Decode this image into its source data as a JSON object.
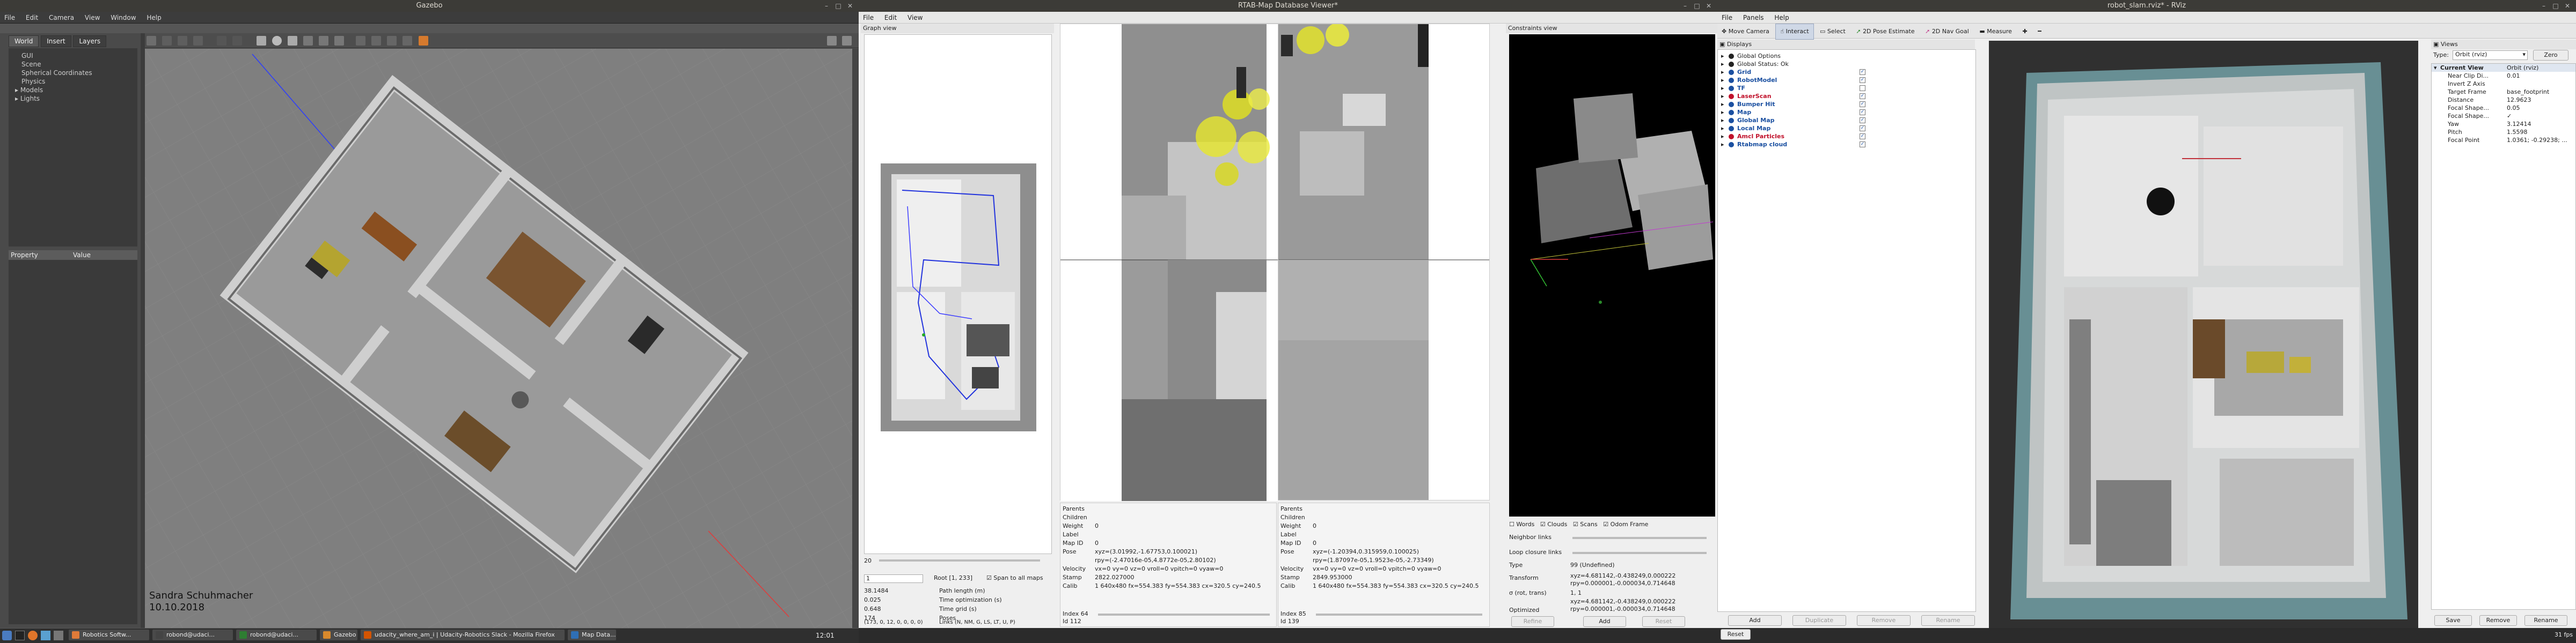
{
  "gazebo": {
    "title": "Gazebo",
    "menu": [
      "File",
      "Edit",
      "Camera",
      "View",
      "Window",
      "Help"
    ],
    "tabs": [
      "World",
      "Insert",
      "Layers"
    ],
    "tree": [
      "GUI",
      "Scene",
      "Spherical Coordinates",
      "Physics",
      "Models",
      "Lights"
    ],
    "prop_headers": [
      "Property",
      "Value"
    ],
    "watermark_name": "Sandra Schuhmacher",
    "watermark_date": "10.10.2018"
  },
  "rtabmap": {
    "title": "RTAB-Map Database Viewer*",
    "menu": [
      "File",
      "Edit",
      "View"
    ],
    "graph_view_title": "Graph view",
    "constraints_view_title": "Constraints view",
    "left_info": {
      "labels": [
        "Parents",
        "Children",
        "Weight",
        "Label",
        "Map ID",
        "Pose",
        "",
        "Velocity",
        "Stamp",
        "Calib"
      ],
      "values": [
        "",
        "",
        "0",
        "",
        "0",
        "xyz=(3.01992,-1.67753,0.100021)",
        "rpy=(-2.47016e-05,4.8772e-05,2.80102)",
        "vx=0 vy=0 vz=0 vroll=0 vpitch=0 vyaw=0",
        "2822.027000",
        "1 640x480 fx=554.383 fy=554.383 cx=320.5 cy=240.5"
      ],
      "index_label": "Index 64",
      "id_label": "Id 112"
    },
    "right_info": {
      "labels": [
        "Parents",
        "Children",
        "Weight",
        "Label",
        "Map ID",
        "Pose",
        "",
        "Velocity",
        "Stamp",
        "Calib"
      ],
      "values": [
        "",
        "",
        "0",
        "",
        "0",
        "xyz=(-1.20394,0.315959,0.100025)",
        "rpy=(1.87097e-05,1.9523e-05,-2.73349)",
        "vx=0 vy=0 vz=0 vroll=0 vpitch=0 vyaw=0",
        "2849.953000",
        "1 640x480 fx=554.383 fy=554.383 cx=320.5 cy=240.5"
      ],
      "index_label": "Index 85",
      "id_label": "Id 139"
    },
    "graph_controls": {
      "spin1": "20",
      "spin2": "1",
      "root": "Root [1, 233]",
      "span_label": "Span to all maps",
      "stats_values": [
        "38.1484",
        "0.025",
        "0.648",
        "174",
        "(173, 0, 12, 0, 0, 0, 0)"
      ],
      "stats_labels": [
        "Path length (m)",
        "Time optimization (s)",
        "Time grid (s)",
        "Poses",
        "Links (N, NM, G, LS, LT, U, P)"
      ]
    },
    "constraint_checks": [
      "Words",
      "Clouds",
      "Scans",
      "Odom Frame"
    ],
    "constraint_fields": {
      "neighbor_links": "Neighbor links",
      "loop_closure_links": "Loop closure links",
      "type_label": "Type",
      "type_value": "99 (Undefined)",
      "transform_label": "Transform",
      "transform_value": "xyz=4.681142,-0.438249,0.000222 rpy=0.000001,-0.000034,0.714648",
      "info_label": "σ (rot, trans)",
      "info_value": "1, 1",
      "optimized_label": "Optimized",
      "optimized_value": "xyz=4.681142,-0.438249,0.000222 rpy=0.000001,-0.000034,0.714648"
    },
    "constraint_buttons": [
      "Refine",
      "Add",
      "Reset"
    ]
  },
  "rviz": {
    "title": "robot_slam.rviz* - RViz",
    "menu": [
      "File",
      "Panels",
      "Help"
    ],
    "tools": [
      "Move Camera",
      "Interact",
      "Select",
      "2D Pose Estimate",
      "2D Nav Goal",
      "Measure"
    ],
    "displays_title": "Displays",
    "displays": [
      {
        "name": "Global Options",
        "checked": false,
        "color": "#222"
      },
      {
        "name": "Global Status: Ok",
        "checked": false,
        "color": "#222"
      },
      {
        "name": "Grid",
        "checked": true,
        "color": "#1a4fa0"
      },
      {
        "name": "RobotModel",
        "checked": true,
        "color": "#1a4fa0"
      },
      {
        "name": "TF",
        "checked": false,
        "color": "#1a4fa0"
      },
      {
        "name": "LaserScan",
        "checked": true,
        "color": "#c0102a"
      },
      {
        "name": "Bumper Hit",
        "checked": true,
        "color": "#1a4fa0"
      },
      {
        "name": "Map",
        "checked": true,
        "color": "#1a4fa0"
      },
      {
        "name": "Global Map",
        "checked": true,
        "color": "#1a4fa0"
      },
      {
        "name": "Local Map",
        "checked": true,
        "color": "#1a4fa0"
      },
      {
        "name": "Amcl Particles",
        "checked": true,
        "color": "#c0102a"
      },
      {
        "name": "Rtabmap cloud",
        "checked": true,
        "color": "#1a4fa0"
      }
    ],
    "display_buttons": [
      "Add",
      "Duplicate",
      "Remove",
      "Rename"
    ],
    "reset_label": "Reset",
    "views_title": "Views",
    "type_label": "Type:",
    "type_value": "Orbit (rviz)",
    "zero_label": "Zero",
    "current_view": {
      "label": "Current View",
      "value": "Orbit (rviz)"
    },
    "view_props": [
      [
        "Near Clip Di...",
        "0.01"
      ],
      [
        "Invert Z Axis",
        ""
      ],
      [
        "Target Frame",
        "base_footprint"
      ],
      [
        "Distance",
        "12.9623"
      ],
      [
        "Focal Shape...",
        "0.05"
      ],
      [
        "Focal Shape...",
        "✓"
      ],
      [
        "Yaw",
        "3.12414"
      ],
      [
        "Pitch",
        "1.5598"
      ],
      [
        "Focal Point",
        "1.0361; -0.29238; ..."
      ]
    ],
    "view_buttons": [
      "Save",
      "Remove",
      "Rename"
    ],
    "fps": "31 fps"
  },
  "taskbar": {
    "items": [
      {
        "label": "Robotics Softw...",
        "color": "#e07b39"
      },
      {
        "label": "robond@udaci...",
        "color": "#444"
      },
      {
        "label": "robond@udaci...",
        "color": "#2e7d32"
      },
      {
        "label": "Gazebo",
        "color": "#d8892c"
      },
      {
        "label": "udacity_where_am_i | Udacity-Robotics Slack - Mozilla Firefox",
        "color": "#d35400"
      },
      {
        "label": "Map Data...",
        "color": "#2f6fb5"
      }
    ],
    "clock": "12:01"
  }
}
